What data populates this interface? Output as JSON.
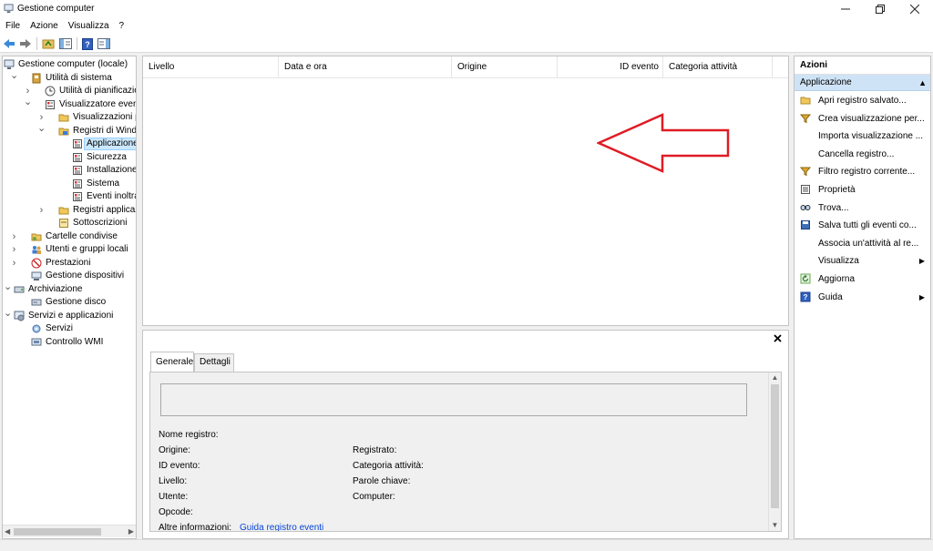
{
  "window": {
    "title": "Gestione computer"
  },
  "menu": [
    "File",
    "Azione",
    "Visualizza",
    "?"
  ],
  "tree": [
    {
      "label": "Gestione computer (locale)",
      "level": 0,
      "expander": "",
      "icon": "computer-management-icon"
    },
    {
      "label": "Utilità di sistema",
      "level": 1,
      "expander": "open",
      "icon": "system-tools-icon"
    },
    {
      "label": "Utilità di pianificazione",
      "level": 2,
      "expander": "closed",
      "icon": "task-scheduler-icon"
    },
    {
      "label": "Visualizzatore eventi",
      "level": 2,
      "expander": "open",
      "icon": "event-viewer-icon"
    },
    {
      "label": "Visualizzazioni perso",
      "level": 3,
      "expander": "closed",
      "icon": "folder-icon"
    },
    {
      "label": "Registri di Windows",
      "level": 3,
      "expander": "open",
      "icon": "windows-logs-icon"
    },
    {
      "label": "Applicazione",
      "level": 4,
      "expander": "",
      "icon": "log-icon",
      "selected": true
    },
    {
      "label": "Sicurezza",
      "level": 4,
      "expander": "",
      "icon": "log-icon"
    },
    {
      "label": "Installazione",
      "level": 4,
      "expander": "",
      "icon": "log-icon"
    },
    {
      "label": "Sistema",
      "level": 4,
      "expander": "",
      "icon": "log-icon"
    },
    {
      "label": "Eventi inoltrati",
      "level": 4,
      "expander": "",
      "icon": "log-icon"
    },
    {
      "label": "Registri applicazioni",
      "level": 3,
      "expander": "closed",
      "icon": "folder-icon"
    },
    {
      "label": "Sottoscrizioni",
      "level": 3,
      "expander": "",
      "icon": "subscriptions-icon"
    },
    {
      "label": "Cartelle condivise",
      "level": 1,
      "expander": "closed",
      "icon": "shared-folders-icon"
    },
    {
      "label": "Utenti e gruppi locali",
      "level": 1,
      "expander": "closed",
      "icon": "users-icon"
    },
    {
      "label": "Prestazioni",
      "level": 1,
      "expander": "closed",
      "icon": "performance-icon"
    },
    {
      "label": "Gestione dispositivi",
      "level": 1,
      "expander": "",
      "icon": "device-manager-icon"
    },
    {
      "label": "Archiviazione",
      "level": 0,
      "expander": "open",
      "icon": "storage-icon"
    },
    {
      "label": "Gestione disco",
      "level": 1,
      "expander": "",
      "icon": "disk-icon"
    },
    {
      "label": "Servizi e applicazioni",
      "level": 0,
      "expander": "open",
      "icon": "services-apps-icon"
    },
    {
      "label": "Servizi",
      "level": 1,
      "expander": "",
      "icon": "services-icon"
    },
    {
      "label": "Controllo WMI",
      "level": 1,
      "expander": "",
      "icon": "wmi-icon"
    }
  ],
  "list": {
    "columns": [
      "Livello",
      "Data e ora",
      "Origine",
      "ID evento",
      "Categoria attività"
    ]
  },
  "detail": {
    "tabs": [
      "Generale",
      "Dettagli"
    ],
    "fields": {
      "nome_registro": "Nome registro:",
      "origine": "Origine:",
      "registrato": "Registrato:",
      "id_evento": "ID evento:",
      "categoria": "Categoria attività:",
      "livello": "Livello:",
      "parole_chiave": "Parole chiave:",
      "utente": "Utente:",
      "computer": "Computer:",
      "opcode": "Opcode:",
      "altre_info": "Altre informazioni:",
      "altre_info_link": "Guida registro eventi"
    }
  },
  "actions": {
    "header": "Azioni",
    "section": "Applicazione",
    "items": [
      {
        "label": "Apri registro salvato...",
        "icon": "open-log-icon"
      },
      {
        "label": "Crea visualizzazione per...",
        "icon": "filter-icon"
      },
      {
        "label": "Importa visualizzazione ...",
        "icon": ""
      },
      {
        "label": "Cancella registro...",
        "icon": ""
      },
      {
        "label": "Filtro registro corrente...",
        "icon": "filter-icon"
      },
      {
        "label": "Proprietà",
        "icon": "properties-icon"
      },
      {
        "label": "Trova...",
        "icon": "find-icon"
      },
      {
        "label": "Salva tutti gli eventi co...",
        "icon": "save-icon"
      },
      {
        "label": "Associa un'attività al re...",
        "icon": ""
      },
      {
        "label": "Visualizza",
        "icon": "",
        "submenu": true
      },
      {
        "label": "Aggiorna",
        "icon": "refresh-icon"
      },
      {
        "label": "Guida",
        "icon": "help-icon",
        "submenu": true
      }
    ]
  },
  "colors": {
    "selection": "#cce8ff",
    "section_bg": "#cfe3f6",
    "link": "#0645d6",
    "arrow": "#e01b24"
  }
}
